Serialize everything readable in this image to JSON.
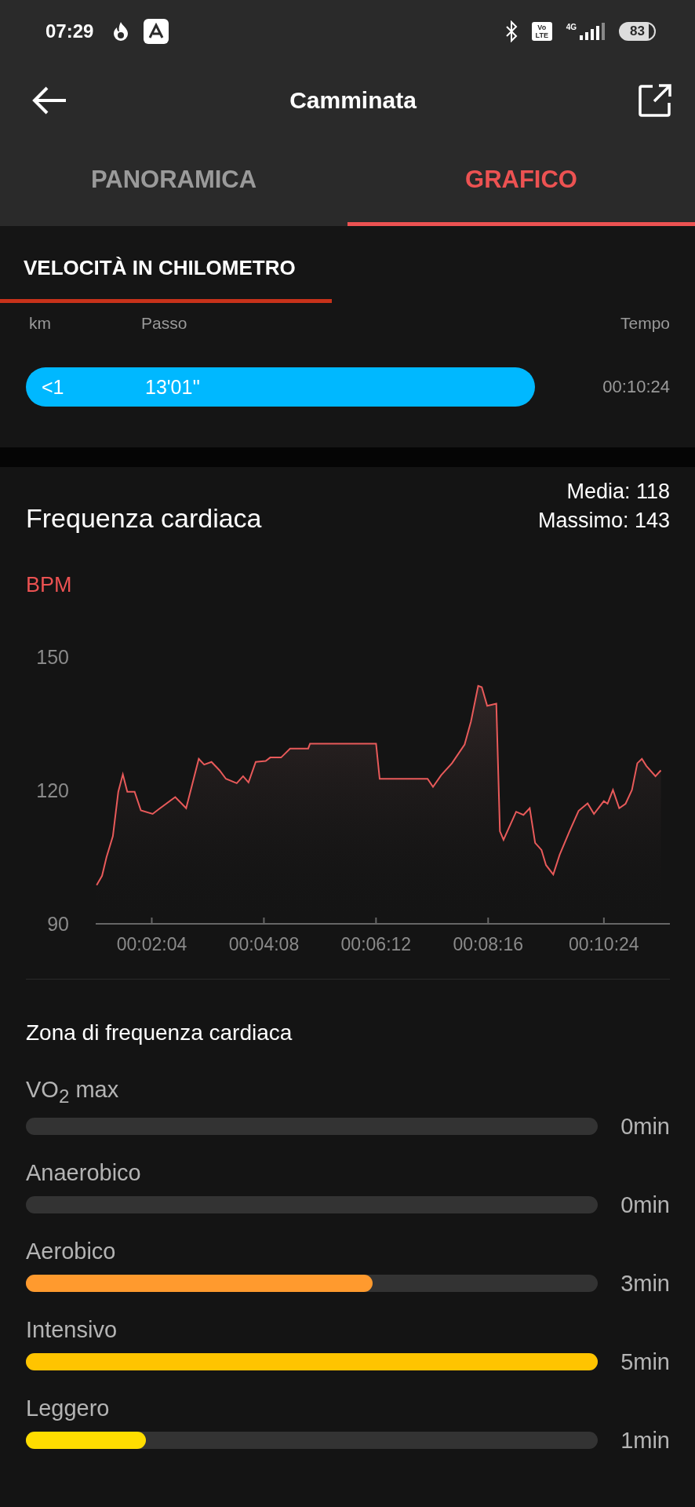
{
  "status_bar": {
    "time": "07:29",
    "volte_top": "Vo",
    "volte_bottom": "LTE",
    "network": "4G",
    "battery": "83"
  },
  "header": {
    "title": "Camminata"
  },
  "tabs": [
    {
      "label": "PANORAMICA",
      "selected": false
    },
    {
      "label": "GRAFICO",
      "selected": true
    }
  ],
  "speed": {
    "title": "VELOCITÀ IN CHILOMETRO",
    "columns": [
      "km",
      "Passo",
      "Tempo"
    ],
    "rows": [
      {
        "km": "<1",
        "pace": "13'01''",
        "time": "00:10:24"
      }
    ]
  },
  "heart_rate": {
    "title": "Frequenza cardiaca",
    "average": "Media: 118",
    "maximum": "Massimo: 143",
    "chart_data": {
      "type": "area",
      "ylabel": "BPM",
      "xlim": [
        62,
        697
      ],
      "ylim": [
        90,
        150
      ],
      "yticks": [
        90,
        120,
        150
      ],
      "xticks": [
        {
          "value": 124,
          "label": "00:02:04"
        },
        {
          "value": 248,
          "label": "00:04:08"
        },
        {
          "value": 372,
          "label": "00:06:12"
        },
        {
          "value": 496,
          "label": "00:08:16"
        },
        {
          "value": 624,
          "label": "00:10:24"
        }
      ],
      "x": [
        63,
        69,
        74,
        81,
        87,
        92,
        97,
        105,
        112,
        125,
        132,
        150,
        162,
        176,
        182,
        190,
        199,
        206,
        218,
        225,
        231,
        239,
        250,
        255,
        267,
        277,
        297,
        299,
        372,
        376,
        429,
        435,
        444,
        456,
        470,
        477,
        485,
        489,
        495,
        505,
        509,
        513,
        527,
        535,
        542,
        548,
        555,
        560,
        568,
        575,
        586,
        596,
        606,
        613,
        624,
        628,
        634,
        641,
        648,
        655,
        661,
        666,
        671,
        681,
        687
      ],
      "series": [
        {
          "color": "#e85a5a",
          "values": [
            98.7,
            100.8,
            105.0,
            109.7,
            119.7,
            123.6,
            119.7,
            119.7,
            115.5,
            114.7,
            115.8,
            118.5,
            116.0,
            127.1,
            125.8,
            126.4,
            124.5,
            122.6,
            121.6,
            123.2,
            121.8,
            126.4,
            126.6,
            127.4,
            127.4,
            129.4,
            129.4,
            130.5,
            130.5,
            122.6,
            122.6,
            120.8,
            123.4,
            126.1,
            130.3,
            135.5,
            143.5,
            143.2,
            139.0,
            139.5,
            110.8,
            108.9,
            115.2,
            114.5,
            116.0,
            108.2,
            106.6,
            103.2,
            101.1,
            105.5,
            110.8,
            115.4,
            117.1,
            114.7,
            117.6,
            117.0,
            120.1,
            116.0,
            117.0,
            120.1,
            126.1,
            127.1,
            125.5,
            123.2,
            124.5
          ]
        }
      ]
    }
  },
  "zones": {
    "title": "Zona di frequenza cardiaca",
    "items": [
      {
        "label": "VO$_{2}$ max",
        "level": 0,
        "value": "0min"
      },
      {
        "label": "Anaerobico",
        "level": 0,
        "value": "0min"
      },
      {
        "label": "Aerobico",
        "level": 0.606,
        "value": "3min",
        "color": "#ff9a2e"
      },
      {
        "label": "Intensivo",
        "level": 1,
        "value": "5min",
        "color": "#ffc400"
      },
      {
        "label": "Leggero",
        "level": 0.21,
        "value": "1min",
        "color": "#ffdd00"
      }
    ]
  }
}
